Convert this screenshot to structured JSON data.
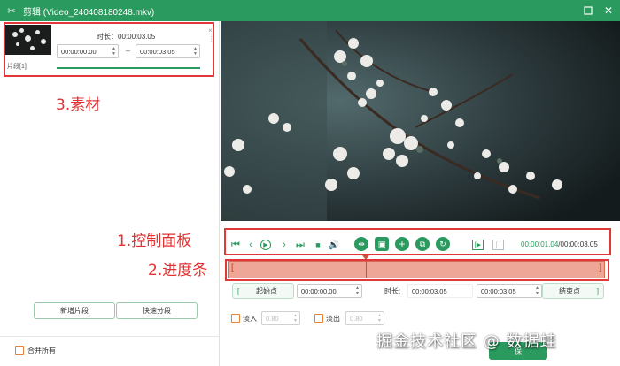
{
  "window": {
    "title": "剪辑 (Video_240408180248.mkv)",
    "app_icon": "scissors-icon",
    "accent_color": "#2a9a5e",
    "maximize_icon": "maximize-icon",
    "close_icon": "close-icon"
  },
  "clip": {
    "label": "片段[1]",
    "duration": "时长：00:00:03.05",
    "start": "00:00:00.00",
    "separator": "–",
    "end": "00:00:03.05",
    "remove_glyph": "×",
    "more_glyph": "⋮"
  },
  "annotations": {
    "material": "3.素材",
    "control_panel": "1.控制面板",
    "progress_bar": "2.进度条",
    "color": "#e03030"
  },
  "buttons": {
    "add_clip": "新增片段",
    "quick_split": "快速分段",
    "save_partial": "保"
  },
  "merge_all": "合并所有",
  "playback": {
    "current": "00:00:01.04",
    "separator": "/",
    "total": "00:00:03.05",
    "icons": [
      "skip-start-icon",
      "prev-frame-icon",
      "play-icon",
      "next-frame-icon",
      "skip-end-icon",
      "stop-icon",
      "volume-icon",
      "split-icon",
      "screenshot-icon",
      "add-icon",
      "copy-icon",
      "reset-icon",
      "mark-in-icon",
      "mark-out-icon"
    ]
  },
  "range": {
    "start_label": "起始点",
    "start_value": "00:00:00.00",
    "duration_label": "时长:",
    "duration_value": "00:00:03.05",
    "end_value": "00:00:03.05",
    "end_label": "结束点"
  },
  "fade": {
    "fade_in_label": "淡入",
    "fade_in_value": "0.80",
    "fade_out_label": "淡出",
    "fade_out_value": "0.80"
  },
  "watermark": "掘金技术社区 @ 数据蛙"
}
